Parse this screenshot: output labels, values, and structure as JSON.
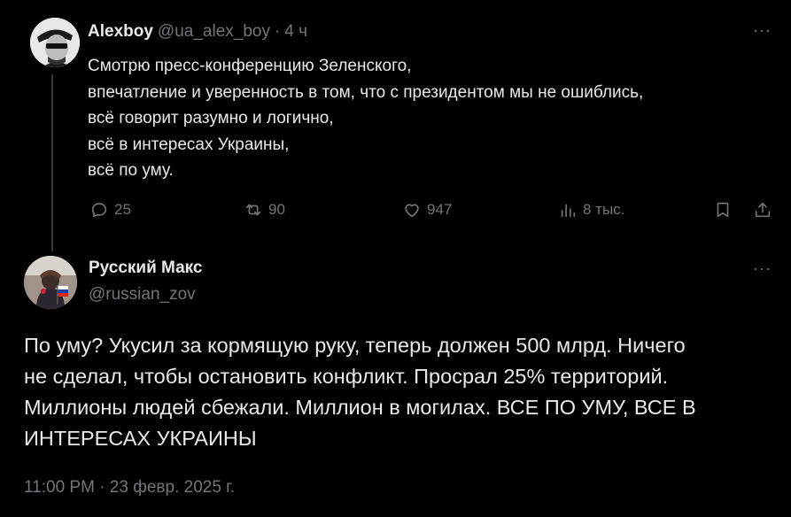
{
  "parent": {
    "name": "Alexboy",
    "handle": "@ua_alex_boy",
    "sep": "·",
    "time": "4 ч",
    "more": "···",
    "lines": [
      "Смотрю пресс-конференцию Зеленского,",
      "впечатление и уверенность в том, что с президентом мы не ошиблись,",
      "всё говорит разумно и логично,",
      "всё в интересах Украины,",
      "всё по уму."
    ],
    "actions": {
      "replies": "25",
      "reposts": "90",
      "likes": "947",
      "views": "8 тыс."
    }
  },
  "main": {
    "name": "Русский Макс",
    "handle": "@russian_zov",
    "more": "···",
    "lines": [
      "По уму?  Укусил за кормящую руку, теперь должен 500 млрд.  Ничего",
      "не сделал, чтобы остановить конфликт.  Просрал 25% территорий.",
      "Миллионы людей сбежали. Миллион в могилах. ВСЕ ПО УМУ, ВСЕ В",
      "ИНТЕРЕСАХ УКРАИНЫ"
    ],
    "timestamp": "11:00 PM · 23 февр. 2025 г."
  },
  "icons": {
    "reply": "reply-icon",
    "repost": "repost-icon",
    "like": "heart-icon",
    "views": "bar-chart-icon",
    "bookmark": "bookmark-icon",
    "share": "share-icon"
  }
}
